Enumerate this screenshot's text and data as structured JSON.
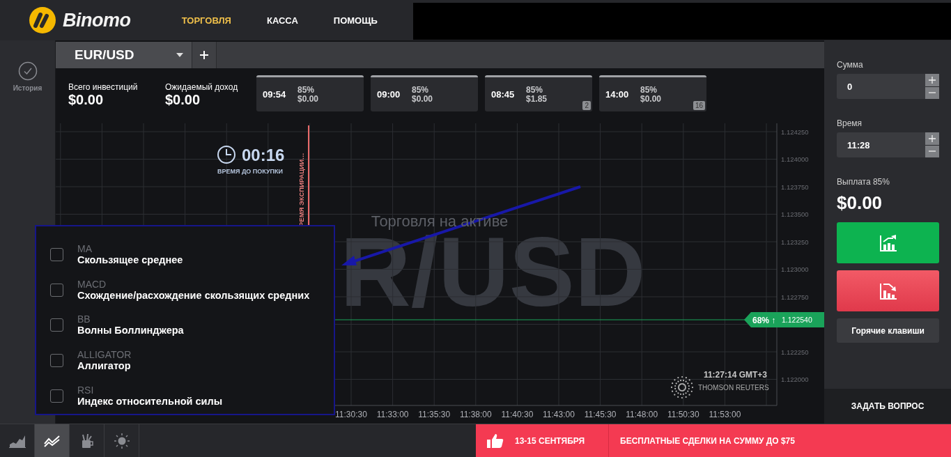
{
  "header": {
    "logo_text": "Binomo",
    "nav": [
      {
        "label": "ТОРГОВЛЯ",
        "selected": true
      },
      {
        "label": "КАССА",
        "selected": false
      },
      {
        "label": "ПОМОЩЬ",
        "selected": false
      }
    ]
  },
  "sidebar": {
    "items": [
      {
        "label": "История"
      }
    ]
  },
  "asset_tab": {
    "label": "EUR/USD"
  },
  "summary": [
    {
      "label": "Всего инвестиций",
      "value": "$0.00"
    },
    {
      "label": "Ожидаемый доход",
      "value": "$0.00"
    }
  ],
  "deals": [
    {
      "time": "09:54",
      "percent": "85%",
      "amount": "$0.00"
    },
    {
      "time": "09:00",
      "percent": "85%",
      "amount": "$0.00"
    },
    {
      "time": "08:45",
      "percent": "85%",
      "amount": "$1.85",
      "count": "2"
    },
    {
      "time": "14:00",
      "percent": "85%",
      "amount": "$0.00",
      "count": "16"
    }
  ],
  "chart": {
    "timer": "00:16",
    "timer_label": "ВРЕМЯ ДО ПОКУПКИ",
    "expiration_label": "РЕМЯ ЭКСПИРАЦИИ…",
    "asset_caption": "Торговля на активе",
    "asset_watermark": "R/USD",
    "y_labels": [
      "1.124250",
      "1.124000",
      "1.123750",
      "1.123500",
      "1.123250",
      "1.123000",
      "1.122750",
      "1.122250",
      "1.122000"
    ],
    "x_labels": [
      "11:30:30",
      "11:33:00",
      "11:35:30",
      "11:38:00",
      "11:40:30",
      "11:43:00",
      "11:45:30",
      "11:48:00",
      "11:50:30",
      "11:53:00"
    ],
    "price_marker": {
      "percent": "68% ↑",
      "price": "1.122540"
    },
    "server_time": "11:27:14 GMT+3",
    "provider": "THOMSON REUTERS"
  },
  "indicator_menu": {
    "items": [
      {
        "code": "MA",
        "name": "Скользящее среднее",
        "checked": false
      },
      {
        "code": "MACD",
        "name": "Схождение/расхождение скользящих средних",
        "checked": false
      },
      {
        "code": "BB",
        "name": "Волны Боллинджера",
        "checked": false
      },
      {
        "code": "ALLIGATOR",
        "name": "Аллигатор",
        "checked": false
      },
      {
        "code": "RSI",
        "name": "Индекс относительной силы",
        "checked": false
      }
    ]
  },
  "trade_panel": {
    "amount_label": "Сумма",
    "amount": "0",
    "time_label": "Время",
    "time": "11:28",
    "payout_label": "Выплата 85%",
    "payout": "$0.00",
    "hotkeys": "Горячие клавиши",
    "ask": "ЗАДАТЬ ВОПРОС"
  },
  "bottom_bar": {
    "tools": [
      {
        "kind": "area",
        "selected": false
      },
      {
        "kind": "indicators",
        "selected": true
      },
      {
        "kind": "drawing",
        "selected": false
      },
      {
        "kind": "theme",
        "selected": false
      }
    ],
    "promo": {
      "date": "13-15 СЕНТЯБРЯ",
      "text": "БЕСПЛАТНЫЕ СДЕЛКИ НА СУММУ ДО $75"
    }
  }
}
